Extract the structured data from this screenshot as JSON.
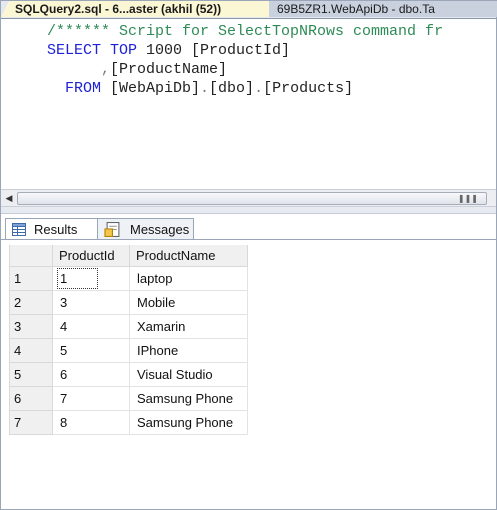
{
  "tabs": {
    "active": "SQLQuery2.sql - 6...aster (akhil (52))",
    "inactive": "69B5ZR1.WebApiDb - dbo.Ta"
  },
  "editor": {
    "lines": [
      {
        "parts": [
          {
            "cls": "cm",
            "text": "/****** Script for SelectTopNRows command fr"
          }
        ]
      },
      {
        "parts": [
          {
            "cls": "kw",
            "text": "SELECT TOP "
          },
          {
            "cls": "tx",
            "text": "1000 [ProductId]"
          }
        ]
      },
      {
        "parts": [
          {
            "cls": "gr",
            "text": "      ,"
          },
          {
            "cls": "tx",
            "text": "[ProductName]"
          }
        ]
      },
      {
        "parts": [
          {
            "cls": "kw",
            "text": "  FROM "
          },
          {
            "cls": "tx",
            "text": "[WebApiDb]"
          },
          {
            "cls": "gr",
            "text": "."
          },
          {
            "cls": "tx",
            "text": "[dbo]"
          },
          {
            "cls": "gr",
            "text": "."
          },
          {
            "cls": "tx",
            "text": "[Products]"
          }
        ]
      }
    ]
  },
  "results_tabs": {
    "results": "Results",
    "messages": "Messages"
  },
  "grid": {
    "columns": [
      "ProductId",
      "ProductName"
    ],
    "rows": [
      {
        "n": "1",
        "id": "1",
        "name": "laptop"
      },
      {
        "n": "2",
        "id": "3",
        "name": "Mobile"
      },
      {
        "n": "3",
        "id": "4",
        "name": "Xamarin"
      },
      {
        "n": "4",
        "id": "5",
        "name": "IPhone"
      },
      {
        "n": "5",
        "id": "6",
        "name": "Visual Studio"
      },
      {
        "n": "6",
        "id": "7",
        "name": "Samsung Phone"
      },
      {
        "n": "7",
        "id": "8",
        "name": "Samsung Phone"
      }
    ]
  }
}
